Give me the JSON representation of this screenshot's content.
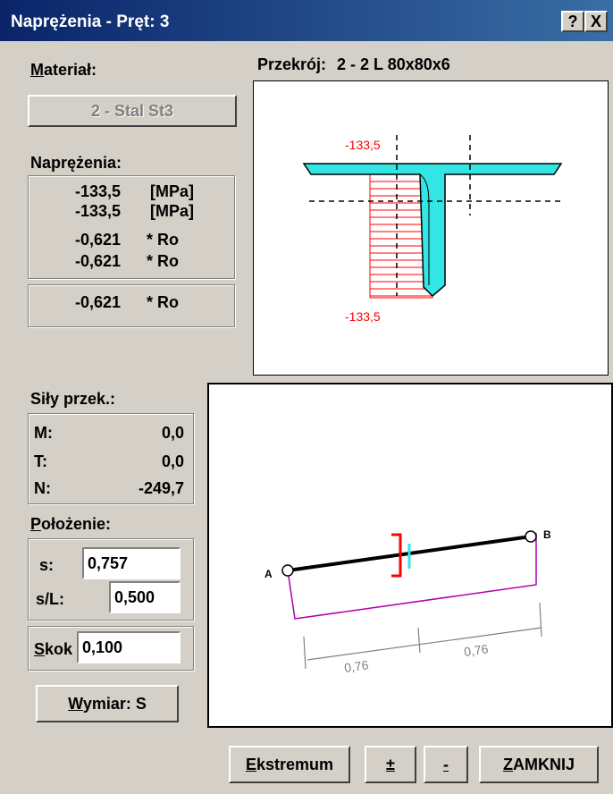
{
  "window": {
    "title": "Naprężenia - Pręt: 3",
    "help_glyph": "?",
    "close_glyph": "X"
  },
  "material": {
    "label_first": "M",
    "label_rest": "ateriał:",
    "button": "2 - Stal St3"
  },
  "przekroj": {
    "label": "Przekrój:",
    "value": "2 - 2 L 80x80x6"
  },
  "stresses": {
    "label": "Naprężenia:",
    "rows": [
      {
        "value": "-133,5",
        "unit": "[MPa]"
      },
      {
        "value": "-133,5",
        "unit": "[MPa]"
      },
      {
        "value": "-0,621",
        "unit": "* Ro"
      },
      {
        "value": "-0,621",
        "unit": "* Ro"
      }
    ],
    "extra": {
      "value": "-0,621",
      "unit": "* Ro"
    }
  },
  "forces": {
    "label": "Siły przek.:",
    "rows": [
      {
        "name": "M:",
        "value": "0,0"
      },
      {
        "name": "T:",
        "value": "0,0"
      },
      {
        "name": "N:",
        "value": "-249,7"
      }
    ]
  },
  "position": {
    "label_first": "P",
    "label_rest": "ołożenie:",
    "s_label": "s:",
    "s_value": "0,757",
    "sl_label": "s/L:",
    "sl_value": "0,500",
    "step_first": "S",
    "step_rest": "kok",
    "step_value": "0,100"
  },
  "dim_button": {
    "first": "W",
    "rest": "ymiar: S"
  },
  "section_diagram": {
    "top_value": "-133,5",
    "bottom_value": "-133,5"
  },
  "beam_diagram": {
    "node_a": "A",
    "node_b": "B",
    "dim_left": "0,76",
    "dim_right": "0,76"
  },
  "buttons": {
    "ekstremum_first": "E",
    "ekstremum_rest": "kstremum",
    "plus": "±",
    "minus": "-",
    "close_first": "Z",
    "close_rest": "AMKNIJ"
  },
  "colors": {
    "section_fill": "#33e6e6",
    "stress_color": "#ff0000",
    "diagram_color": "#b000b0",
    "titlebar": "#0a246a"
  }
}
